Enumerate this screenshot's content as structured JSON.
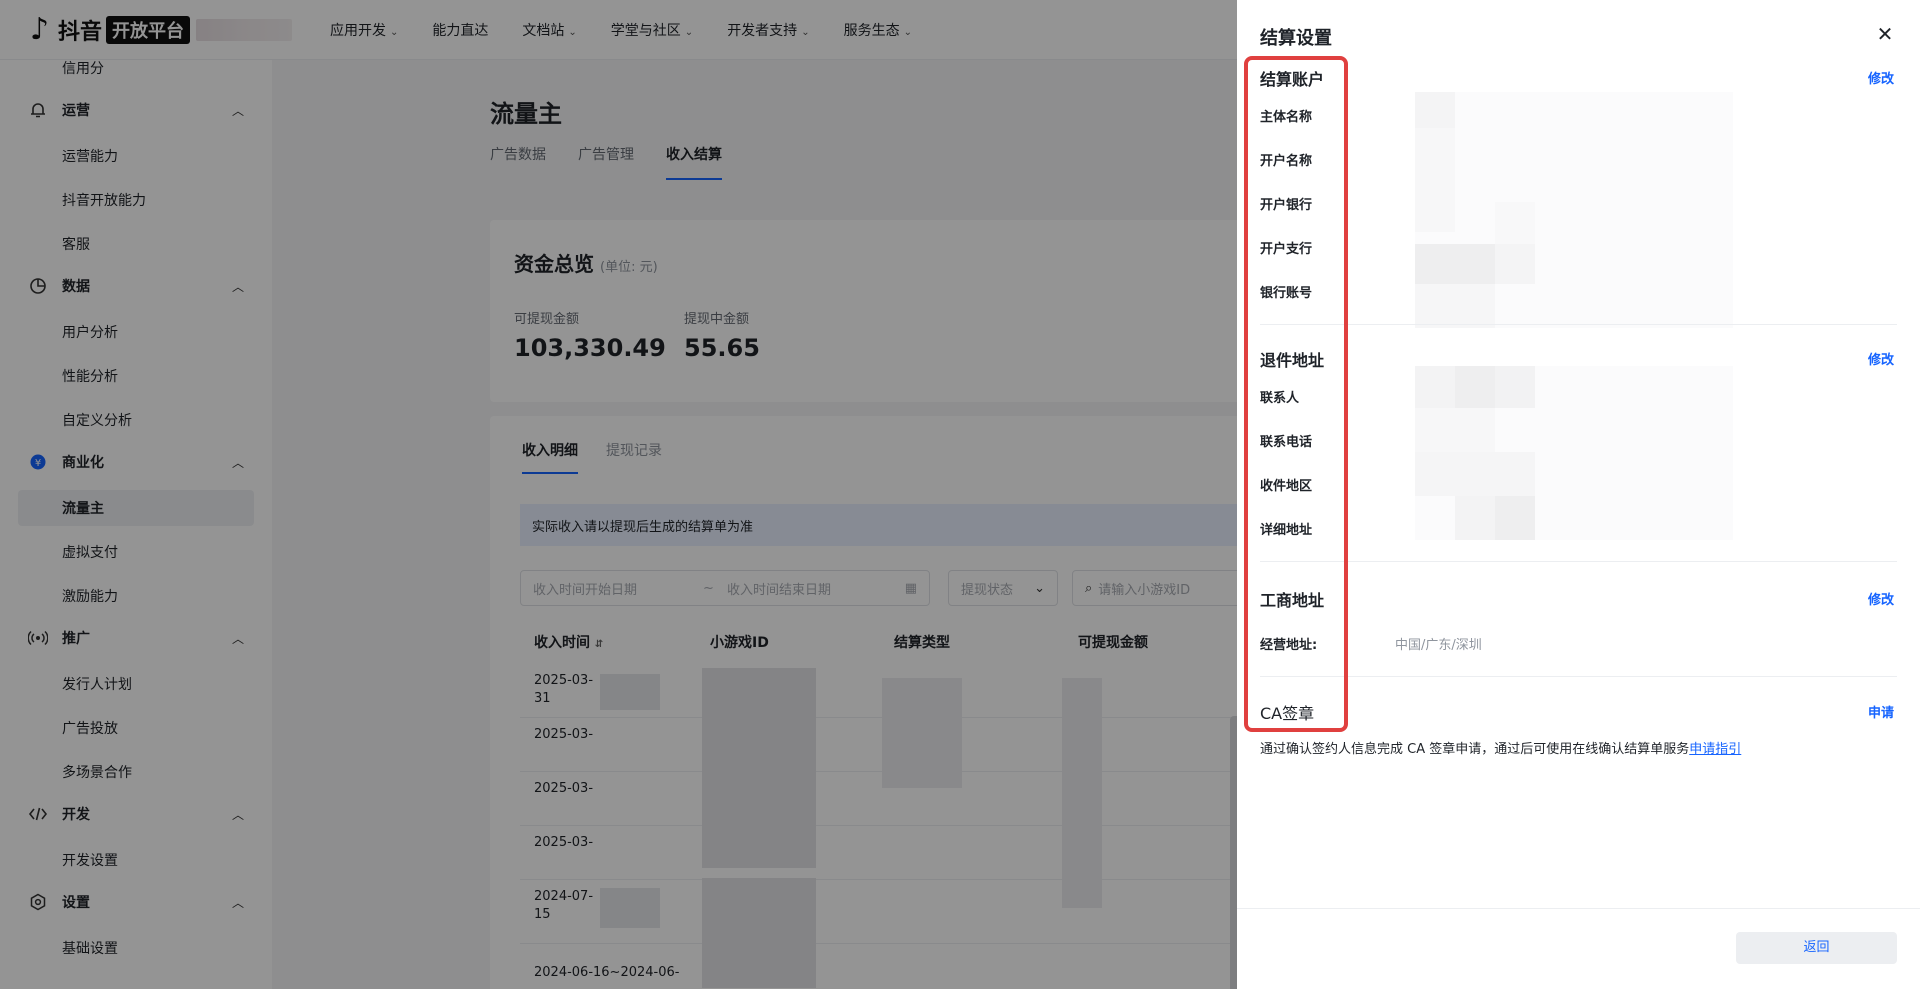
{
  "header": {
    "logo_text": "抖音",
    "logo_badge": "开放平台",
    "nav": [
      {
        "label": "应用开发",
        "has_menu": true
      },
      {
        "label": "能力直达",
        "has_menu": false
      },
      {
        "label": "文档站",
        "has_menu": true
      },
      {
        "label": "学堂与社区",
        "has_menu": true
      },
      {
        "label": "开发者支持",
        "has_menu": true
      },
      {
        "label": "服务生态",
        "has_menu": true
      }
    ]
  },
  "sidebar": {
    "top_item": "信用分",
    "groups": [
      {
        "label": "运营",
        "icon": "bell-icon",
        "items": [
          "运营能力",
          "抖音开放能力",
          "客服"
        ]
      },
      {
        "label": "数据",
        "icon": "pie-chart-icon",
        "items": [
          "用户分析",
          "性能分析",
          "自定义分析"
        ]
      },
      {
        "label": "商业化",
        "icon": "yen-coin-icon",
        "items": [
          "流量主",
          "虚拟支付",
          "激励能力"
        ]
      },
      {
        "label": "推广",
        "icon": "broadcast-icon",
        "items": [
          "发行人计划",
          "广告投放",
          "多场景合作"
        ]
      },
      {
        "label": "开发",
        "icon": "code-icon",
        "items": [
          "开发设置"
        ]
      },
      {
        "label": "设置",
        "icon": "settings-icon",
        "items": [
          "基础设置"
        ]
      }
    ],
    "active_item": "流量主"
  },
  "main": {
    "title": "流量主",
    "tabs": [
      "广告数据",
      "广告管理",
      "收入结算"
    ],
    "active_tab": "收入结算",
    "fund": {
      "title": "资金总览",
      "unit": "(单位: 元)",
      "withdrawable_label": "可提现金额",
      "withdrawable_value": "103,330.49",
      "pending_label": "提现中金额",
      "pending_value": "55.65"
    },
    "subtabs": [
      "收入明细",
      "提现记录"
    ],
    "active_subtab": "收入明细",
    "notice": "实际收入请以提现后生成的结算单为准",
    "filters": {
      "start_placeholder": "收入时间开始日期",
      "sep": "~",
      "end_placeholder": "收入时间结束日期",
      "status_placeholder": "提现状态",
      "search_placeholder": "请输入小游戏ID"
    },
    "table": {
      "columns": [
        "收入时间",
        "小游戏ID",
        "结算类型",
        "可提现金额"
      ],
      "rows": [
        "2025-03-31",
        "2025-03-",
        "2025-03-",
        "2025-03-",
        "2024-07-15",
        "2024-06-16~2024-06-"
      ]
    }
  },
  "drawer": {
    "title": "结算设置",
    "account": {
      "title": "结算账户",
      "edit": "修改",
      "fields": [
        "主体名称",
        "开户名称",
        "开户银行",
        "开户支行",
        "银行账号"
      ]
    },
    "return_address": {
      "title": "退件地址",
      "edit": "修改",
      "fields": [
        "联系人",
        "联系电话",
        "收件地区",
        "详细地址"
      ]
    },
    "business_address": {
      "title": "工商地址",
      "edit": "修改",
      "field_label": "经营地址:",
      "field_value": "中国/广东/深圳"
    },
    "ca": {
      "title": "CA签章",
      "apply": "申请",
      "desc": "通过确认签约人信息完成 CA 签章申请，通过后可使用在线确认结算单服务",
      "guide_link": "申请指引"
    },
    "back_button": "返回"
  }
}
